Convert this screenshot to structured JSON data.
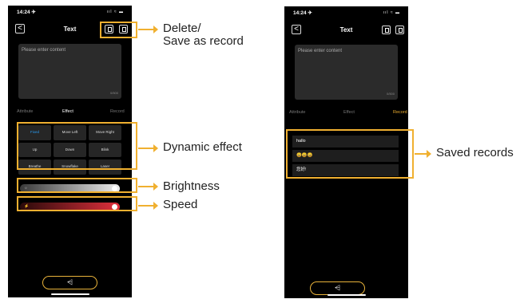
{
  "left_phone": {
    "time": "14:24 ✈",
    "status_icons": "ııl ≈ ▬",
    "back": "<",
    "title": "Text",
    "content_placeholder": "Please enter content",
    "counter": "0/500",
    "tabs": [
      "Attribute",
      "Effect",
      "Record"
    ],
    "effects": [
      "Fixed",
      "Move Left",
      "Move Right",
      "Up",
      "Down",
      "Blink",
      "Breathe",
      "Snowflake",
      "Laser"
    ],
    "brightness_label": "☼",
    "speed_label": "⚡",
    "send_icon": "⩤"
  },
  "right_phone": {
    "time": "14:24 ✈",
    "status_icons": "ııl ≈ ▬",
    "back": "<",
    "title": "Text",
    "content_placeholder": "Please enter content",
    "counter": "0/500",
    "tabs": [
      "Attribute",
      "Effect",
      "Record"
    ],
    "records": [
      "hallo",
      "😀😀😀",
      "您好!"
    ],
    "send_icon": "⩤"
  },
  "callouts": {
    "delete_save": "Delete/\nSave as record",
    "dynamic_effect": "Dynamic effect",
    "brightness": "Brightness",
    "speed": "Speed",
    "saved_records": "Saved records"
  },
  "colors": {
    "accent": "#f0b030",
    "selected_effect": "#2a9df4",
    "speed_red": "#e0303c"
  }
}
